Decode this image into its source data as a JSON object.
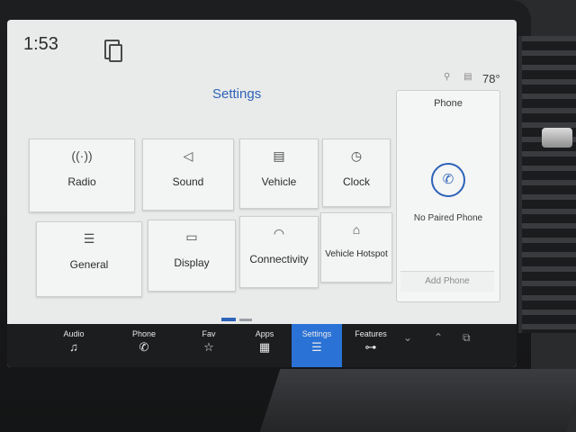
{
  "status_bar": {
    "time": "1:53",
    "temperature": "78°"
  },
  "settings": {
    "title": "Settings",
    "tiles": [
      {
        "label": "Radio",
        "icon": "radio-icon",
        "glyph": "((·))"
      },
      {
        "label": "Sound",
        "icon": "speaker-icon",
        "glyph": "◁"
      },
      {
        "label": "Vehicle",
        "icon": "vehicle-icon",
        "glyph": "▤"
      },
      {
        "label": "Clock",
        "icon": "clock-icon",
        "glyph": "◷"
      },
      {
        "label": "General",
        "icon": "sliders-icon",
        "glyph": "☰"
      },
      {
        "label": "Display",
        "icon": "display-icon",
        "glyph": "▭"
      },
      {
        "label": "Connectivity",
        "icon": "wifi-icon",
        "glyph": "◠"
      },
      {
        "label": "Vehicle Hotspot",
        "icon": "hotspot-icon",
        "glyph": "⌂"
      }
    ]
  },
  "phone_card": {
    "title": "Phone",
    "status": "No Paired Phone",
    "add_button": "Add Phone",
    "glyph": "✆"
  },
  "nav_bar": {
    "items": [
      {
        "label": "Audio",
        "icon": "music-note-icon",
        "glyph": "♫"
      },
      {
        "label": "Phone",
        "icon": "phone-icon",
        "glyph": "✆"
      },
      {
        "label": "Fav",
        "icon": "star-icon",
        "glyph": "☆"
      },
      {
        "label": "Apps",
        "icon": "apps-grid-icon",
        "glyph": "▦"
      },
      {
        "label": "Settings",
        "icon": "settings-sliders-icon",
        "glyph": "☰"
      },
      {
        "label": "Features",
        "icon": "car-icon",
        "glyph": "⊶"
      }
    ],
    "active": "Settings"
  },
  "colors": {
    "accent": "#2d63b9",
    "nav_active": "#2a72d6",
    "screen_bg": "#e9eaea",
    "nav_bg": "#1c1d1f"
  }
}
